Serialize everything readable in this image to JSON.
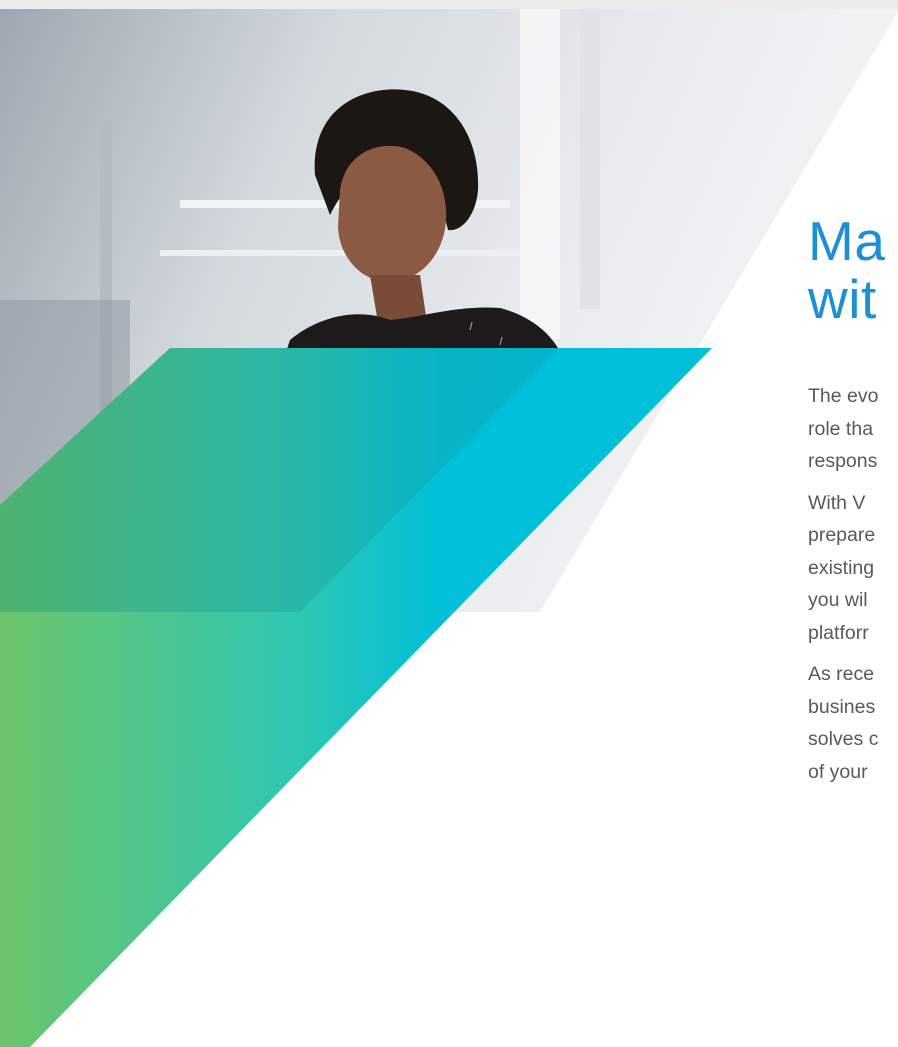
{
  "headline": {
    "line1": "Ma",
    "line2": "wit"
  },
  "paragraphs": [
    [
      "The evo",
      "role tha",
      "respons"
    ],
    [
      "With V",
      "prepare",
      "existing",
      "you wil",
      "platforr"
    ],
    [
      "As rece",
      "busines",
      "solves c",
      "of your"
    ]
  ],
  "colors": {
    "headline": "#1d8fd6",
    "body_text": "#555a60",
    "gradient_green": "#6cc56a",
    "gradient_cyan": "#00bfd8"
  }
}
